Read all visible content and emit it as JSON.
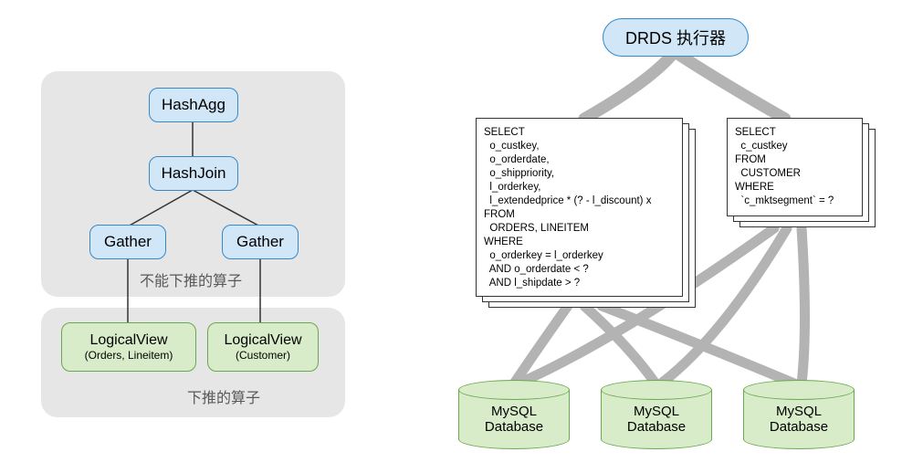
{
  "left": {
    "hashAgg": "HashAgg",
    "hashJoin": "HashJoin",
    "gather1": "Gather",
    "gather2": "Gather",
    "lv1": "LogicalView",
    "lv1sub": "(Orders, Lineitem)",
    "lv2": "LogicalView",
    "lv2sub": "(Customer)",
    "label1": "不能下推的算子",
    "label2": "下推的算子"
  },
  "right": {
    "drds": "DRDS 执行器",
    "sql1": "SELECT\n  o_custkey,\n  o_orderdate,\n  o_shippriority,\n  l_orderkey,\n  l_extendedprice * (? - l_discount) x\nFROM\n  ORDERS, LINEITEM\nWHERE\n  o_orderkey = l_orderkey\n  AND o_orderdate < ?\n  AND l_shipdate > ?",
    "sql2": "SELECT\n  c_custkey\nFROM\n  CUSTOMER\nWHERE\n  `c_mktsegment` = ?",
    "db": "MySQL\nDatabase"
  }
}
